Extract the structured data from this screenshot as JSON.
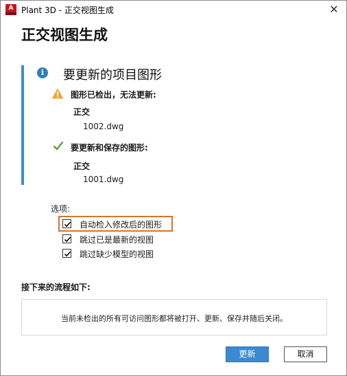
{
  "window": {
    "title": "Plant 3D - 正交视图生成",
    "app_icon_letter": "A",
    "close_glyph": "✕"
  },
  "heading": "正交视图生成",
  "info": {
    "icon_glyph": "i",
    "title": "要更新的项目图形",
    "warning_label": "图形已检出，无法更新:",
    "warning_group": "正交",
    "warning_file": "1002.dwg",
    "ok_label": "要更新和保存的图形:",
    "ok_group": "正交",
    "ok_file": "1001.dwg"
  },
  "options": {
    "label": "选项:",
    "items": [
      {
        "label": "自动检入修改后的图形",
        "checked": true
      },
      {
        "label": "跳过已是最新的视图",
        "checked": true
      },
      {
        "label": "跳过缺少模型的视图",
        "checked": true
      }
    ]
  },
  "next": {
    "label": "接下来的流程如下:",
    "text": "当前未检出的所有可访问图形都将被打开、更新、保存并随后关闭。"
  },
  "buttons": {
    "update": "更新",
    "cancel": "取消"
  },
  "colors": {
    "accent": "#3b8ad1",
    "info_bar": "#3c8ecb",
    "warning": "#f0a534",
    "success": "#5aa03c",
    "highlight": "#d9722a"
  }
}
